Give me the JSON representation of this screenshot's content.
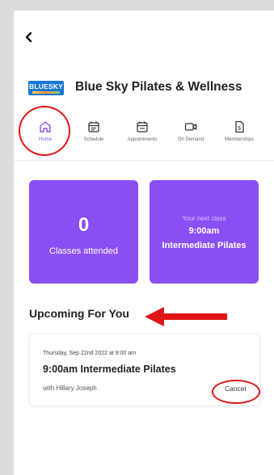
{
  "header": {
    "back_icon": "chevron-left-icon"
  },
  "brand": {
    "logo_text": "BLUESKY",
    "studio_name": "Blue Sky Pilates & Wellness",
    "logo_color": "#1877d2"
  },
  "tabs": [
    {
      "label": "Home",
      "icon": "home-icon",
      "active": true
    },
    {
      "label": "Schedule",
      "icon": "calendar-icon",
      "active": false
    },
    {
      "label": "Appointments",
      "icon": "calendar-icon",
      "active": false
    },
    {
      "label": "On Demand",
      "icon": "video-icon",
      "active": false
    },
    {
      "label": "Memberships",
      "icon": "membership-icon",
      "active": false
    }
  ],
  "stats": {
    "classes_attended_count": "0",
    "classes_attended_label": "Classes attended",
    "next_class_label": "Your next class",
    "next_class_time": "9:00am",
    "next_class_name": "Intermediate Pilates"
  },
  "upcoming": {
    "title": "Upcoming For You",
    "events": [
      {
        "date": "Thursday, Sep 22nd 2022 at 9:00 am",
        "title": "9:00am Intermediate Pilates",
        "instructor": "with Hillary Joseph",
        "action": "Cancel"
      }
    ]
  },
  "colors": {
    "accent": "#8a4ff2",
    "annotation": "#e01515",
    "background": "#dcdcdc"
  }
}
